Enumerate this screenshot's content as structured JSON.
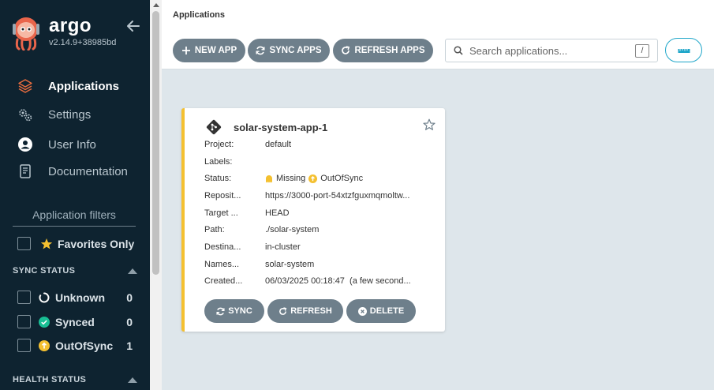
{
  "sidebar": {
    "brand": "argo",
    "version": "v2.14.9+38985bd",
    "nav": [
      {
        "label": "Applications",
        "icon": "layers-icon",
        "active": true
      },
      {
        "label": "Settings",
        "icon": "gears-icon"
      },
      {
        "label": "User Info",
        "icon": "user-circle-icon"
      },
      {
        "label": "Documentation",
        "icon": "book-icon"
      }
    ],
    "filters_title": "Application filters",
    "favorites_label": "Favorites Only",
    "sync_status_title": "SYNC STATUS",
    "sync_status": [
      {
        "label": "Unknown",
        "count": "0"
      },
      {
        "label": "Synced",
        "count": "0"
      },
      {
        "label": "OutOfSync",
        "count": "1"
      }
    ],
    "health_status_title": "HEALTH STATUS"
  },
  "topbar": {
    "breadcrumb": "Applications",
    "new_app": "NEW APP",
    "sync_apps": "SYNC APPS",
    "refresh_apps": "REFRESH APPS",
    "search_placeholder": "Search applications...",
    "search_shortcut": "/"
  },
  "card": {
    "title": "solar-system-app-1",
    "rows": [
      {
        "key": "Project:",
        "value": "default"
      },
      {
        "key": "Labels:",
        "value": ""
      },
      {
        "key": "Status:",
        "health": "Missing",
        "sync": "OutOfSync"
      },
      {
        "key": "Reposit...",
        "value": "https://3000-port-54xtzfguxmqmoltw..."
      },
      {
        "key": "Target ...",
        "value": "HEAD"
      },
      {
        "key": "Path:",
        "value": "./solar-system"
      },
      {
        "key": "Destina...",
        "value": "in-cluster"
      },
      {
        "key": "Names...",
        "value": "solar-system"
      },
      {
        "key": "Created...",
        "value": "06/03/2025 00:18:47  (a few second..."
      }
    ],
    "sync_btn": "SYNC",
    "refresh_btn": "REFRESH",
    "delete_btn": "DELETE"
  },
  "colors": {
    "sidebar_bg": "#0e2330",
    "accent_orange": "#e96d3f",
    "synced_green": "#18be94",
    "outofsync_yellow": "#f4c030",
    "button_gray": "#6e7f8b",
    "toggle_blue": "#1fa6c9"
  }
}
